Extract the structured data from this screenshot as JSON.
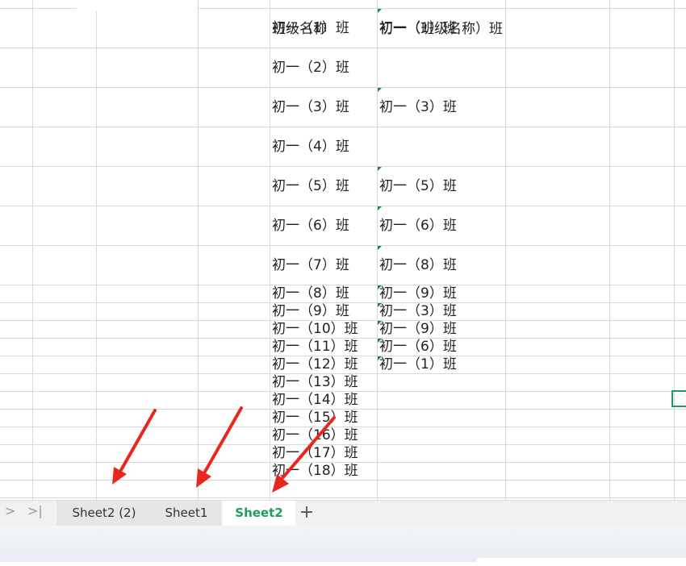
{
  "sheet": {
    "col_c": [
      "班级名称",
      "初一（1）班",
      "初一（2）班",
      "初一（3）班",
      "初一（4）班",
      "初一（5）班",
      "初一（6）班",
      "初一（7）班",
      "初一（8）班",
      "初一（9）班",
      "初一（10）班",
      "初一（11）班",
      "初一（12）班",
      "初一（13）班",
      "初一（14）班",
      "初一（15）班",
      "初一（16）班",
      "初一（17）班",
      "初一（18）班"
    ],
    "col_d": [
      "初一（班级名称）班",
      "初一（1）班",
      "",
      "初一（3）班",
      "",
      "初一（5）班",
      "初一（6）班",
      "初一（8）班",
      "初一（9）班",
      "初一（3）班",
      "初一（9）班",
      "初一（6）班",
      "初一（1）班",
      "",
      "",
      "",
      "",
      "",
      ""
    ]
  },
  "tabs": {
    "nav_next": ">",
    "nav_last": ">|",
    "items": [
      "Sheet2 (2)",
      "Sheet1",
      "Sheet2"
    ],
    "active_index": 2,
    "add": "+"
  },
  "colors": {
    "accent": "#1e9e5e",
    "arrow": "#e8281e",
    "indicator": "#1a8a3a"
  }
}
